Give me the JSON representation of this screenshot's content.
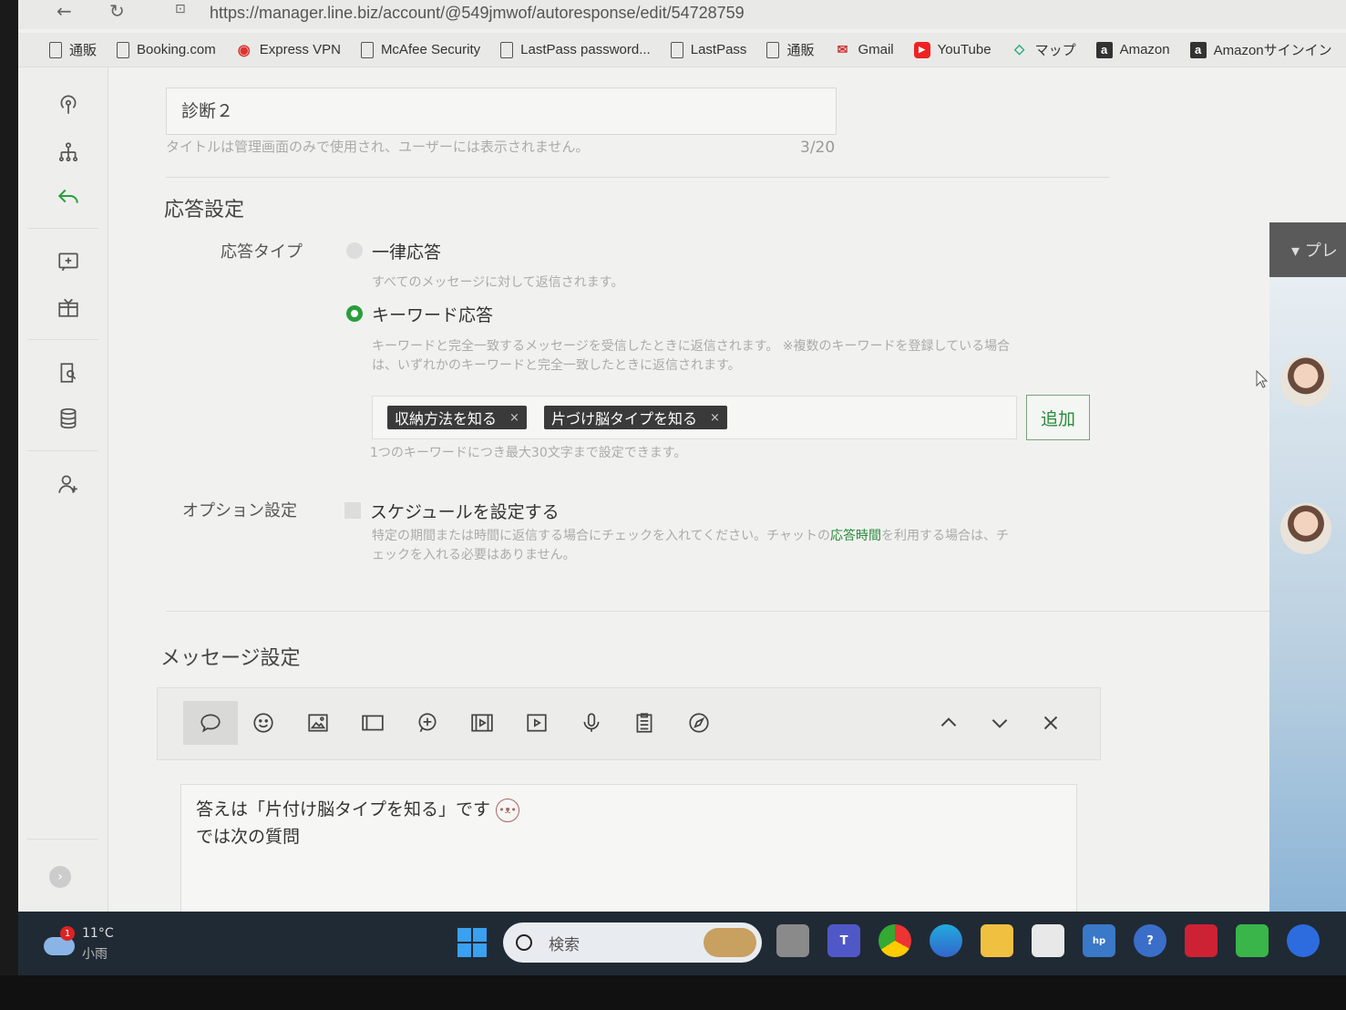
{
  "browser": {
    "url": "https://manager.line.biz/account/@549jmwof/autoresponse/edit/54728759",
    "bookmarks": [
      {
        "label": "通販",
        "icon": "doc-icon"
      },
      {
        "label": "Booking.com",
        "icon": "doc-icon"
      },
      {
        "label": "Express VPN",
        "icon": "vpn-icon"
      },
      {
        "label": "McAfee Security",
        "icon": "doc-icon"
      },
      {
        "label": "LastPass password...",
        "icon": "doc-icon"
      },
      {
        "label": "LastPass",
        "icon": "doc-icon"
      },
      {
        "label": "通販",
        "icon": "doc-icon"
      },
      {
        "label": "Gmail",
        "icon": "gmail-icon"
      },
      {
        "label": "YouTube",
        "icon": "youtube-icon"
      },
      {
        "label": "マップ",
        "icon": "maps-icon"
      },
      {
        "label": "Amazon",
        "icon": "amazon-icon"
      },
      {
        "label": "Amazonサインイン",
        "icon": "amazon-icon"
      }
    ]
  },
  "title_field": {
    "value": "診断２",
    "help": "タイトルは管理画面のみで使用され、ユーザーには表示されません。",
    "count": "3/20"
  },
  "response_settings": {
    "heading": "応答設定",
    "type_label": "応答タイプ",
    "option_uniform": {
      "label": "一律応答",
      "help": "すべてのメッセージに対して返信されます。"
    },
    "option_keyword": {
      "label": "キーワード応答",
      "help_line1": "キーワードと完全一致するメッセージを受信したときに返信されます。 ※複数のキーワードを登録している場合",
      "help_line2": "は、いずれかのキーワードと完全一致したときに返信されます。"
    },
    "keywords": [
      "収納方法を知る",
      "片づけ脳タイプを知る"
    ],
    "tag_remove": "×",
    "add_button": "追加",
    "keyword_help": "1つのキーワードにつき最大30文字まで設定できます。",
    "option_label": "オプション設定",
    "schedule_label": "スケジュールを設定する",
    "schedule_help_a": "特定の期間または時間に返信する場合にチェックを入れてください。チャットの",
    "schedule_help_link": "応答時間",
    "schedule_help_b": "を利用する場合は、チ",
    "schedule_help_line2": "ェックを入れる必要はありません。"
  },
  "message_settings": {
    "heading": "メッセージ設定",
    "message_line1": "答えは「片付け脳タイプを知る」です",
    "message_line2": "では次の質問"
  },
  "right_panel": {
    "head": "▾ プレ"
  },
  "taskbar": {
    "temp": "11°C",
    "condition": "小雨",
    "notification_count": "1",
    "search_placeholder": "検索"
  },
  "colors": {
    "accent_green": "#2a9e3a",
    "tag_bg": "#3a3a3a",
    "taskbar_bg": "#202a34"
  }
}
